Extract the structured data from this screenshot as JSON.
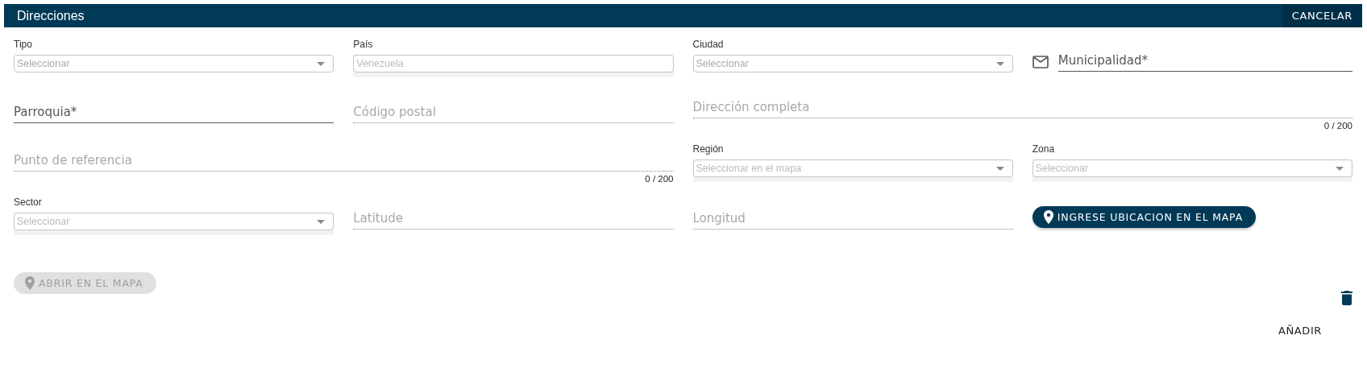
{
  "header": {
    "title": "Direcciones",
    "cancel_button": "CANCELAR"
  },
  "fields": [
    {
      "kind": "select",
      "label": "Tipo",
      "placeholder": "Seleccionar",
      "disabled": false
    },
    {
      "kind": "boxed",
      "label": "País",
      "value": "Venezuela",
      "disabled": true
    },
    {
      "kind": "select",
      "label": "Ciudad",
      "placeholder": "Seleccionar",
      "disabled": false
    },
    {
      "kind": "text",
      "placeholder": "Municipalidad*",
      "disabled": false,
      "has_icon": true
    },
    {
      "kind": "text",
      "placeholder": "Parroquia*",
      "disabled": false,
      "has_icon": false
    },
    {
      "kind": "text",
      "placeholder": "Código postal",
      "disabled": true,
      "has_icon": false
    },
    {
      "kind": "textarea",
      "placeholder": "Dirección completa",
      "counter": "0 / 200",
      "disabled": true
    },
    {
      "kind": "textarea",
      "placeholder": "Punto de referencia",
      "counter": "0 / 200",
      "disabled": true
    },
    {
      "kind": "select",
      "label": "Región",
      "placeholder": "Seleccionar en el mapa",
      "disabled": true
    },
    {
      "kind": "select",
      "label": "Zona",
      "placeholder": "Seleccionar",
      "disabled": true
    },
    {
      "kind": "select",
      "label": "Sector",
      "placeholder": "Seleccionar",
      "disabled": true
    },
    {
      "kind": "text",
      "placeholder": "Latitude",
      "disabled": true,
      "has_icon": false
    },
    {
      "kind": "text",
      "placeholder": "Longitud",
      "disabled": true,
      "has_icon": false
    },
    {
      "kind": "map_button",
      "label": "INGRESE UBICACION EN EL MAPA",
      "disabled": false
    }
  ],
  "open_map_button": {
    "label": "ABRIR EN EL MAPA",
    "disabled": true
  },
  "add_button": "AÑADIR"
}
